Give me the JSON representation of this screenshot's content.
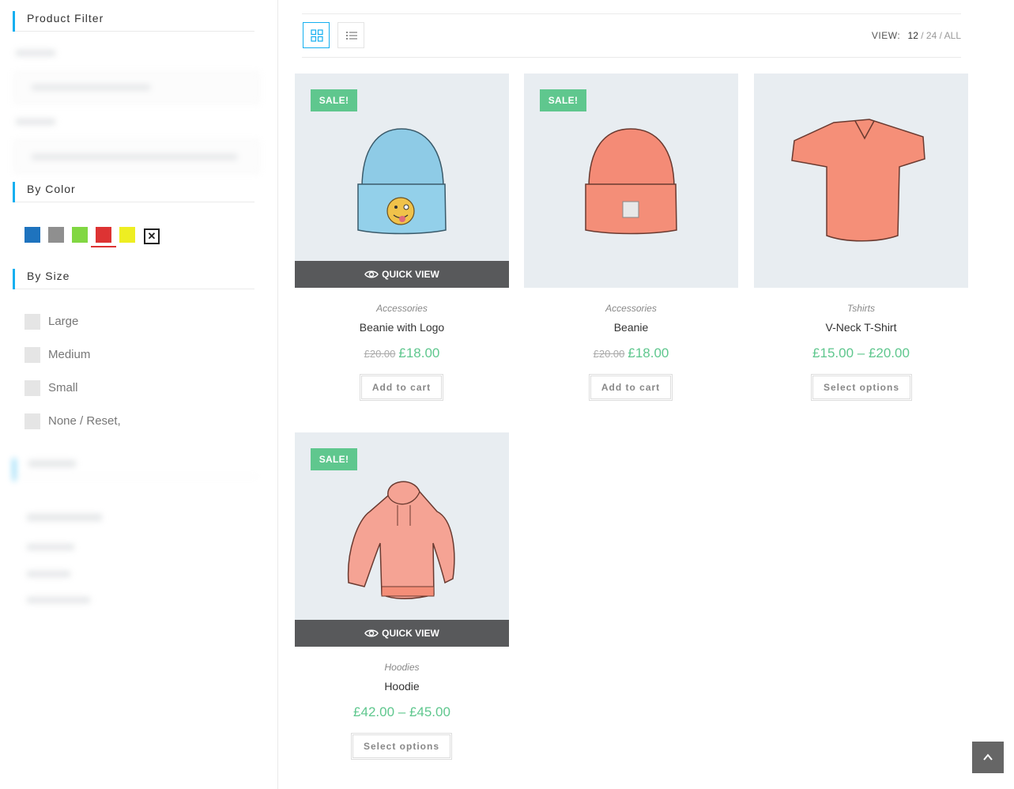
{
  "sidebar": {
    "product_filter_title": "Product Filter",
    "by_color_title": "By Color",
    "by_size_title": "By Size",
    "colors": [
      {
        "name": "blue",
        "hex": "#1e73be"
      },
      {
        "name": "gray",
        "hex": "#8f8f8f"
      },
      {
        "name": "green",
        "hex": "#81d742"
      },
      {
        "name": "red",
        "hex": "#dd3333"
      },
      {
        "name": "yellow",
        "hex": "#eeee22"
      }
    ],
    "reset_icon": "close-icon",
    "sizes": [
      "Large",
      "Medium",
      "Small",
      "None / Reset,"
    ]
  },
  "toolbar": {
    "view_label": "VIEW:",
    "view_options": [
      "12",
      "24",
      "ALL"
    ],
    "separator": "/"
  },
  "products": [
    {
      "category": "Accessories",
      "name": "Beanie with Logo",
      "old_price": "£20.00",
      "price": "£18.00",
      "sale_badge": "SALE!",
      "quickview": "QUICK VIEW",
      "button": "Add to cart",
      "image": "blue-beanie-with-logo"
    },
    {
      "category": "Accessories",
      "name": "Beanie",
      "old_price": "£20.00",
      "price": "£18.00",
      "sale_badge": "SALE!",
      "button": "Add to cart",
      "image": "orange-beanie"
    },
    {
      "category": "Tshirts",
      "name": "V-Neck T-Shirt",
      "price": "£15.00 – £20.00",
      "button": "Select options",
      "image": "orange-vneck-tshirt"
    },
    {
      "category": "Hoodies",
      "name": "Hoodie",
      "price": "£42.00 – £45.00",
      "sale_badge": "SALE!",
      "quickview": "QUICK VIEW",
      "button": "Select options",
      "image": "pink-hoodie"
    }
  ],
  "colors": {
    "accent": "#13aff0",
    "sale": "#5fc78e",
    "price": "#5fc78e",
    "quickview_bg": "#58595b"
  }
}
